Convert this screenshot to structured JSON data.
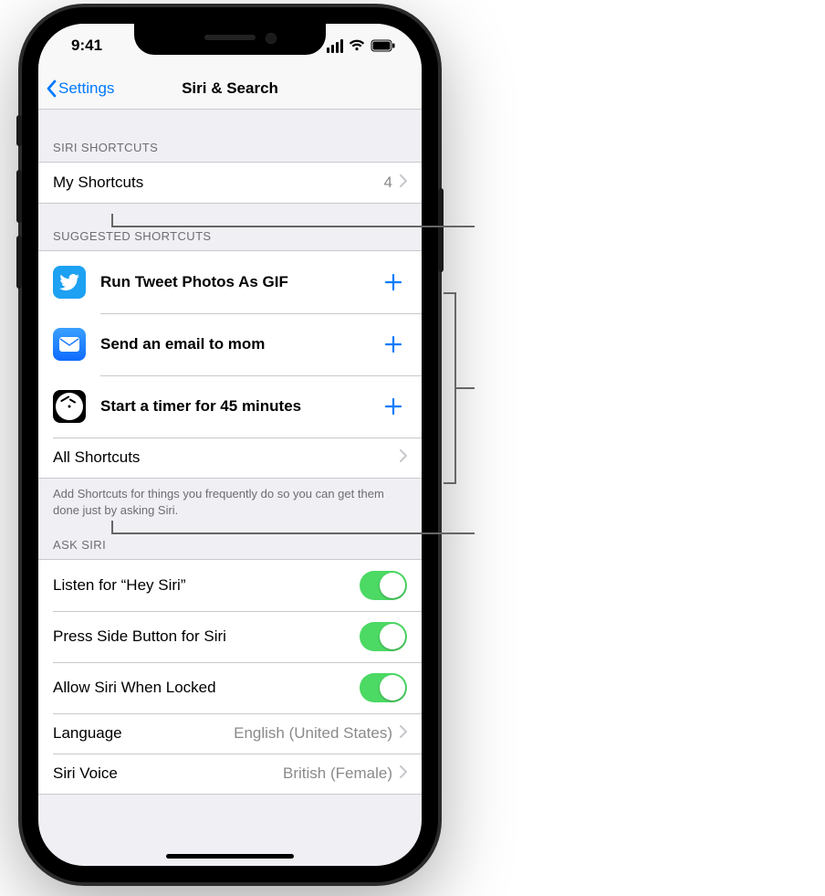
{
  "status_bar": {
    "time": "9:41"
  },
  "nav": {
    "back_label": "Settings",
    "title": "Siri & Search"
  },
  "sections": {
    "siri_shortcuts": {
      "header": "SIRI SHORTCUTS",
      "my_shortcuts": {
        "label": "My Shortcuts",
        "count": "4"
      }
    },
    "suggested": {
      "header": "SUGGESTED SHORTCUTS",
      "items": [
        {
          "app": "twitter",
          "label": "Run Tweet Photos As GIF"
        },
        {
          "app": "mail",
          "label": "Send an email to mom"
        },
        {
          "app": "clock",
          "label": "Start a timer for 45 minutes"
        }
      ],
      "all_label": "All Shortcuts",
      "footer": "Add Shortcuts for things you frequently do so you can get them done just by asking Siri."
    },
    "ask_siri": {
      "header": "ASK SIRI",
      "rows": [
        {
          "label": "Listen for “Hey Siri”",
          "on": true
        },
        {
          "label": "Press Side Button for Siri",
          "on": true
        },
        {
          "label": "Allow Siri When Locked",
          "on": true
        }
      ],
      "language": {
        "label": "Language",
        "value": "English (United States)"
      },
      "voice": {
        "label": "Siri Voice",
        "value": "British (Female)"
      }
    }
  }
}
